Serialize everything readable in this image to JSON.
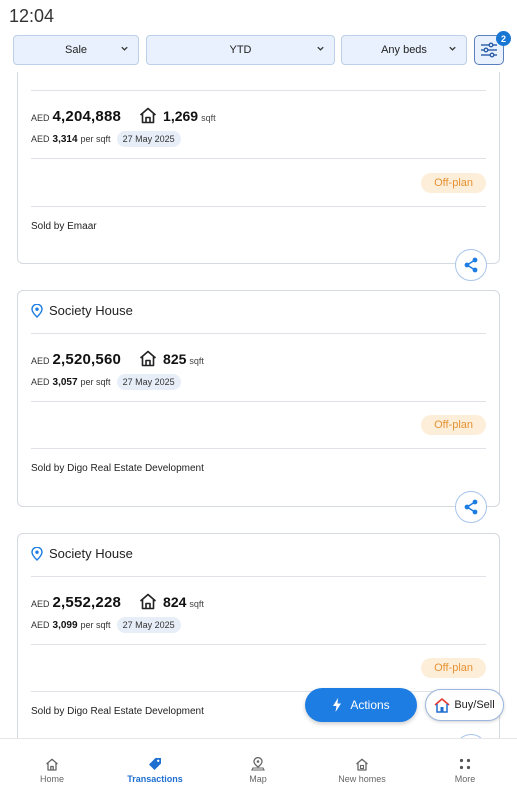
{
  "status": {
    "time": "12:04"
  },
  "filters": {
    "type": "Sale",
    "period": "YTD",
    "beds": "Any beds",
    "active_count": "2"
  },
  "colors": {
    "accent": "#1e7de2",
    "offplan_bg": "#fdeed9",
    "offplan_text": "#e69233"
  },
  "transactions": [
    {
      "title": "",
      "currency": "AED",
      "price": "4,204,888",
      "area": "1,269",
      "area_unit": "sqft",
      "ppsf_currency": "AED",
      "price_per_sqft": "3,314",
      "per_sqft_label": "per sqft",
      "date": "27 May 2025",
      "status": "Off-plan",
      "seller": "Sold by Emaar"
    },
    {
      "title": "Society House",
      "currency": "AED",
      "price": "2,520,560",
      "area": "825",
      "area_unit": "sqft",
      "ppsf_currency": "AED",
      "price_per_sqft": "3,057",
      "per_sqft_label": "per sqft",
      "date": "27 May 2025",
      "status": "Off-plan",
      "seller": "Sold by Digo Real Estate Development"
    },
    {
      "title": "Society House",
      "currency": "AED",
      "price": "2,552,228",
      "area": "824",
      "area_unit": "sqft",
      "ppsf_currency": "AED",
      "price_per_sqft": "3,099",
      "per_sqft_label": "per sqft",
      "date": "27 May 2025",
      "status": "Off-plan",
      "seller": "Sold by Digo Real Estate Development"
    }
  ],
  "fab": {
    "actions": "Actions",
    "buysell": "Buy/Sell"
  },
  "nav": [
    {
      "label": "Home",
      "icon": "home-icon"
    },
    {
      "label": "Transactions",
      "icon": "tag-icon"
    },
    {
      "label": "Map",
      "icon": "map-pin-icon"
    },
    {
      "label": "New homes",
      "icon": "new-home-icon"
    },
    {
      "label": "More",
      "icon": "more-dots-icon"
    }
  ]
}
